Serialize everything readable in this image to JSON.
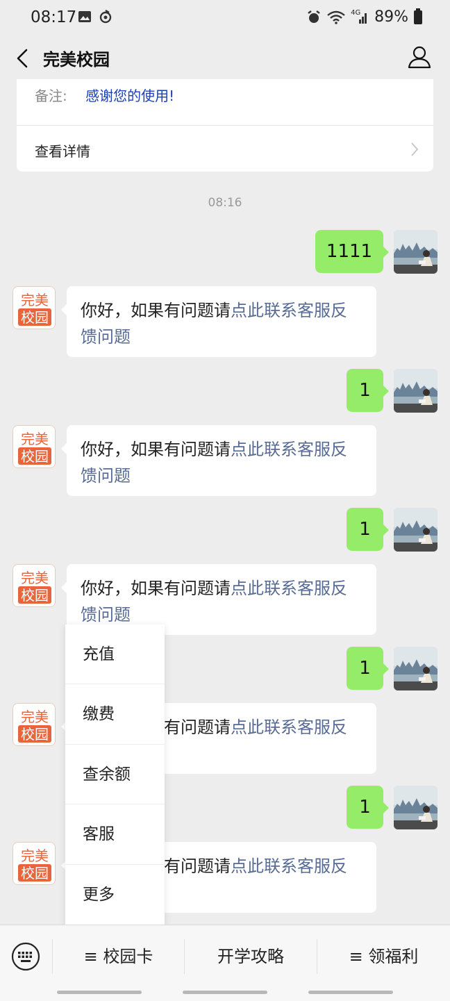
{
  "status_bar": {
    "time": "08:17",
    "battery": "89%",
    "network": "4G"
  },
  "header": {
    "title": "完美校园"
  },
  "card": {
    "note_label": "备注:",
    "note_value": "感谢您的使用!",
    "detail_label": "查看详情"
  },
  "timestamp": "08:16",
  "bot": {
    "avatar_text_top": "完美",
    "avatar_text_bottom": "校园",
    "reply_prefix": "你好，如果有问题请",
    "reply_link_line1": "点此联系客服反",
    "reply_link_line2": "馈问题"
  },
  "messages_out": [
    "1111",
    "1",
    "1",
    "1",
    "1"
  ],
  "popup_menu": {
    "items": [
      "充值",
      "缴费",
      "查余额",
      "客服",
      "更多"
    ]
  },
  "bottom_menu": {
    "items": [
      "≡ 校园卡",
      "开学攻略",
      "≡ 领福利"
    ]
  },
  "colors": {
    "sent_bubble": "#95ec69",
    "link": "#576b95",
    "note_value": "#1b3fb8",
    "brand": "#e8643c"
  }
}
